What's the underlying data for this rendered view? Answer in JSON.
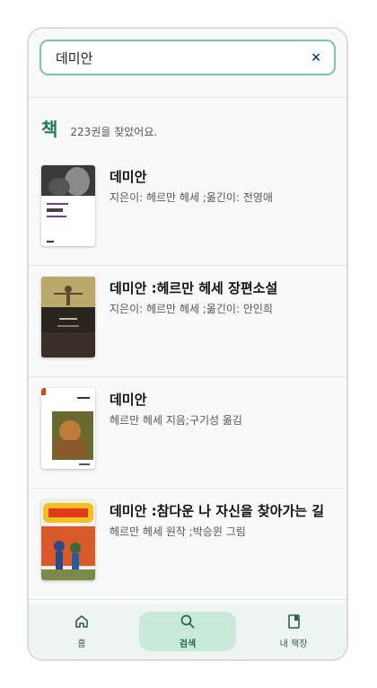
{
  "search": {
    "value": "데미안",
    "clear_label": "×"
  },
  "section": {
    "title": "책",
    "count_text": "223권을 찾았어요."
  },
  "books": [
    {
      "title": "데미안",
      "author": "지은이: 헤르만 헤세 ;옮긴이: 전영애"
    },
    {
      "title": "데미안 :헤르만 헤세 장편소설",
      "author": "지은이: 헤르만 헤세 ;옮긴이: 안인희"
    },
    {
      "title": "데미안",
      "author": "헤르만 헤세 지음;구기성 옮김"
    },
    {
      "title": "데미안 :참다운 나 자신을 찾아가는 길",
      "author": "헤르만 헤세 원작 ;박승윈 그림"
    }
  ],
  "nav": {
    "home": {
      "label": "홈",
      "icon": "home-icon"
    },
    "search": {
      "label": "검색",
      "icon": "search-icon"
    },
    "shelf": {
      "label": "내 책장",
      "icon": "bookshelf-icon"
    }
  },
  "colors": {
    "accent": "#1f7a58",
    "search_border": "#7fc4a6",
    "nav_active": "#c9ead9"
  }
}
